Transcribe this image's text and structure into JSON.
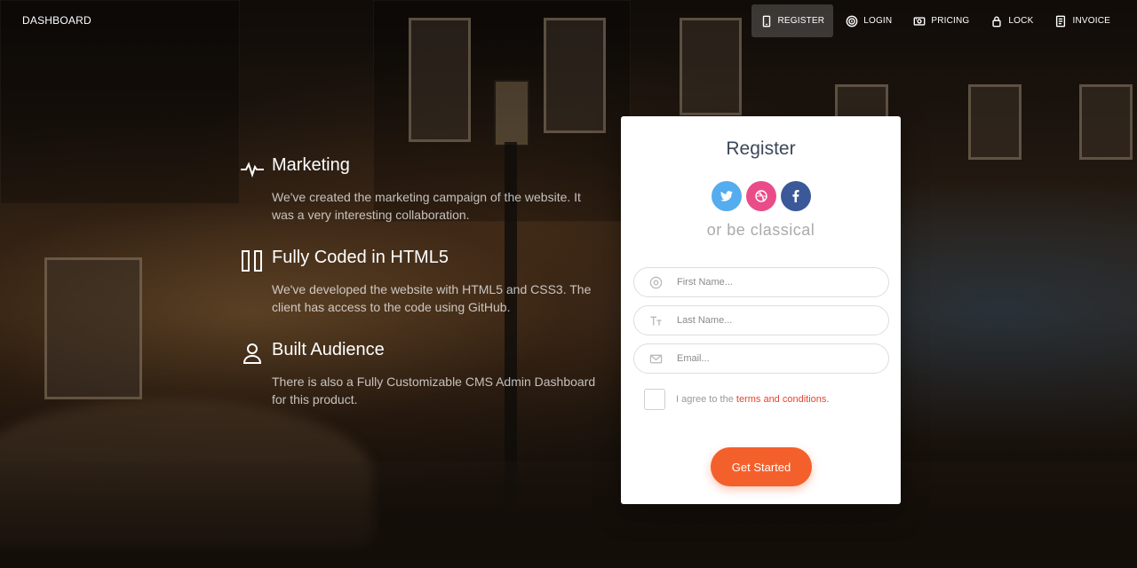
{
  "nav": {
    "brand": "DASHBOARD",
    "links": [
      {
        "label": "REGISTER",
        "icon": "tablet-icon",
        "active": true
      },
      {
        "label": "LOGIN",
        "icon": "fingerprint-icon",
        "active": false
      },
      {
        "label": "PRICING",
        "icon": "money-icon",
        "active": false
      },
      {
        "label": "LOCK",
        "icon": "lock-icon",
        "active": false
      },
      {
        "label": "INVOICE",
        "icon": "document-icon",
        "active": false
      }
    ]
  },
  "features": [
    {
      "title": "Marketing",
      "icon": "pulse-icon",
      "text": "We've created the marketing campaign of the website. It was a very interesting collaboration."
    },
    {
      "title": "Fully Coded in HTML5",
      "icon": "columns-icon",
      "text": "We've developed the website with HTML5 and CSS3. The client has access to the code using GitHub."
    },
    {
      "title": "Built Audience",
      "icon": "user-icon",
      "text": "There is also a Fully Customizable CMS Admin Dashboard for this product."
    }
  ],
  "card": {
    "title": "Register",
    "subtitle": "or be classical",
    "socials": [
      {
        "name": "twitter",
        "color": "#55acee"
      },
      {
        "name": "dribbble",
        "color": "#ea4c89"
      },
      {
        "name": "facebook",
        "color": "#3b5998"
      }
    ],
    "fields": {
      "first_name_placeholder": "First Name...",
      "last_name_placeholder": "Last Name...",
      "email_placeholder": "Email..."
    },
    "agree_prefix": "I agree to the ",
    "agree_link": "terms and conditions.",
    "submit_label": "Get Started",
    "accent_color": "#f4602b"
  }
}
